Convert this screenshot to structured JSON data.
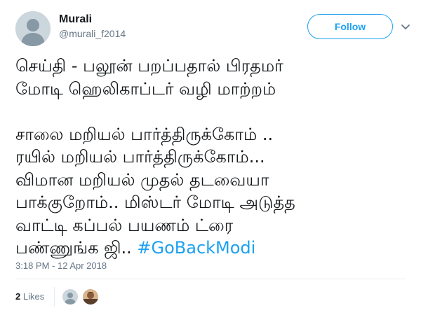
{
  "user": {
    "display_name": "Murali",
    "handle": "@murali_f2014",
    "avatar_icon": "default-avatar-icon"
  },
  "actions": {
    "follow_label": "Follow",
    "caret_icon": "chevron-down-icon"
  },
  "tweet": {
    "text": "செய்தி -  பலூன் பறப்பதால்  பிரதமர்\nமோடி  ஹெலிகாப்டர் வழி மாற்றம்\n\nசாலை மறியல் பார்த்திருக்கோம் ..\nரயில் மறியல் பார்த்திருக்கோம்...\nவிமான மறியல் முதல் தடவையா\nபாக்குறோம்..  மிஸ்டர் மோடி  அடுத்த\nவாட்டி கப்பல் பயணம் ட்ரை\nபண்ணுங்க ஜி.. ",
    "hashtag": "#GoBackModi",
    "timestamp": "3:18 PM - 12 Apr 2018"
  },
  "engagement": {
    "likes_count": "2",
    "likes_label": "Likes",
    "likers": [
      "default-avatar-icon",
      "person-photo-avatar"
    ]
  },
  "colors": {
    "accent": "#1da1f2",
    "secondary_text": "#657786",
    "primary_text": "#14171a",
    "divider": "#e6ecf0"
  }
}
